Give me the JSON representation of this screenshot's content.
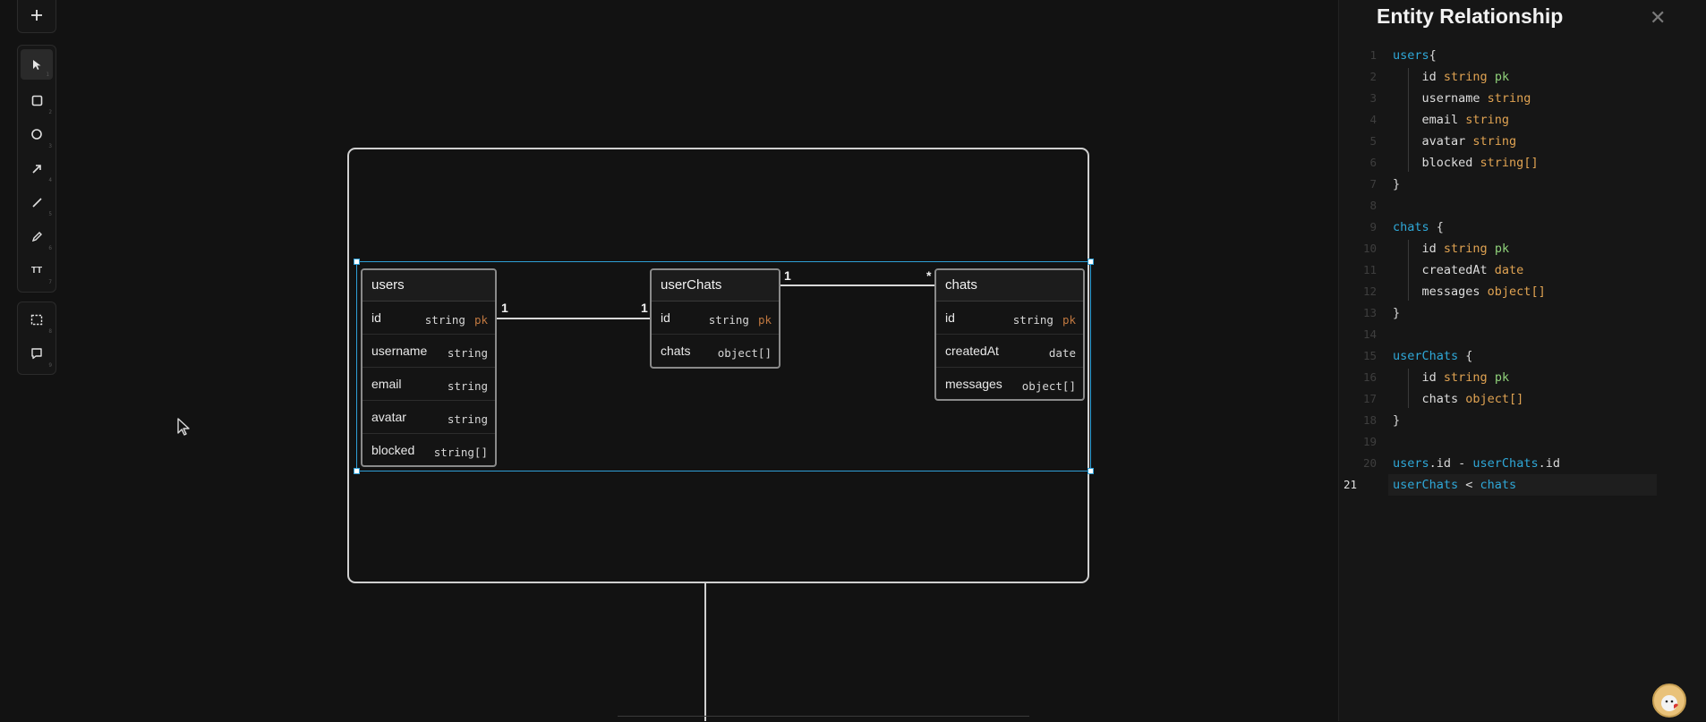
{
  "toolbar": {
    "add_button": {
      "icon": "plus-icon",
      "key": ""
    },
    "tools": [
      {
        "name": "select",
        "icon": "pointer-icon",
        "key": "1",
        "active": true
      },
      {
        "name": "rectangle",
        "icon": "square-icon",
        "key": "2"
      },
      {
        "name": "ellipse",
        "icon": "circle-icon",
        "key": "3"
      },
      {
        "name": "arrow",
        "icon": "arrow-icon",
        "key": "4"
      },
      {
        "name": "line",
        "icon": "line-icon",
        "key": "5"
      },
      {
        "name": "pencil",
        "icon": "pencil-icon",
        "key": "6"
      },
      {
        "name": "text",
        "icon": "text-icon",
        "label": "TT",
        "key": "7"
      }
    ],
    "extra": [
      {
        "name": "frame",
        "icon": "frame-icon",
        "key": "8"
      },
      {
        "name": "comment",
        "icon": "comment-icon",
        "key": "9"
      }
    ]
  },
  "diagram": {
    "entities": {
      "users": {
        "name": "users",
        "fields": [
          {
            "name": "id",
            "type": "string",
            "pk": "pk"
          },
          {
            "name": "username",
            "type": "string",
            "pk": ""
          },
          {
            "name": "email",
            "type": "string",
            "pk": ""
          },
          {
            "name": "avatar",
            "type": "string",
            "pk": ""
          },
          {
            "name": "blocked",
            "type": "string[]",
            "pk": ""
          }
        ]
      },
      "userChats": {
        "name": "userChats",
        "fields": [
          {
            "name": "id",
            "type": "string",
            "pk": "pk"
          },
          {
            "name": "chats",
            "type": "object[]",
            "pk": ""
          }
        ]
      },
      "chats": {
        "name": "chats",
        "fields": [
          {
            "name": "id",
            "type": "string",
            "pk": "pk"
          },
          {
            "name": "createdAt",
            "type": "date",
            "pk": ""
          },
          {
            "name": "messages",
            "type": "object[]",
            "pk": ""
          }
        ]
      }
    },
    "relations": {
      "users_userChats": {
        "from_card": "1",
        "to_card": "1"
      },
      "userChats_chats": {
        "from_card": "1",
        "to_card": "*"
      }
    }
  },
  "panel": {
    "title": "Entity Relationship",
    "close_icon": "close-icon",
    "current_line": 21,
    "code_lines": [
      [
        {
          "t": "users",
          "c": "ent"
        },
        {
          "t": "{",
          "c": "punc"
        }
      ],
      [
        {
          "t": "    id ",
          "c": "field"
        },
        {
          "t": "string ",
          "c": "type"
        },
        {
          "t": "pk",
          "c": "pk"
        }
      ],
      [
        {
          "t": "    username ",
          "c": "field"
        },
        {
          "t": "string",
          "c": "type"
        }
      ],
      [
        {
          "t": "    email ",
          "c": "field"
        },
        {
          "t": "string",
          "c": "type"
        }
      ],
      [
        {
          "t": "    avatar ",
          "c": "field"
        },
        {
          "t": "string",
          "c": "type"
        }
      ],
      [
        {
          "t": "    blocked ",
          "c": "field"
        },
        {
          "t": "string[]",
          "c": "type"
        }
      ],
      [
        {
          "t": "}",
          "c": "punc"
        }
      ],
      [],
      [
        {
          "t": "chats ",
          "c": "ent"
        },
        {
          "t": "{",
          "c": "punc"
        }
      ],
      [
        {
          "t": "    id ",
          "c": "field"
        },
        {
          "t": "string ",
          "c": "type"
        },
        {
          "t": "pk",
          "c": "pk"
        }
      ],
      [
        {
          "t": "    createdAt ",
          "c": "field"
        },
        {
          "t": "date",
          "c": "type"
        }
      ],
      [
        {
          "t": "    messages ",
          "c": "field"
        },
        {
          "t": "object[]",
          "c": "type"
        }
      ],
      [
        {
          "t": "}",
          "c": "punc"
        }
      ],
      [],
      [
        {
          "t": "userChats ",
          "c": "ent"
        },
        {
          "t": "{",
          "c": "punc"
        }
      ],
      [
        {
          "t": "    id ",
          "c": "field"
        },
        {
          "t": "string ",
          "c": "type"
        },
        {
          "t": "pk",
          "c": "pk"
        }
      ],
      [
        {
          "t": "    chats ",
          "c": "field"
        },
        {
          "t": "object[]",
          "c": "type"
        }
      ],
      [
        {
          "t": "}",
          "c": "punc"
        }
      ],
      [],
      [
        {
          "t": "users",
          "c": "ent"
        },
        {
          "t": ".id - ",
          "c": "punc"
        },
        {
          "t": "userChats",
          "c": "ent"
        },
        {
          "t": ".id",
          "c": "punc"
        }
      ],
      [
        {
          "t": "userChats",
          "c": "ent"
        },
        {
          "t": " < ",
          "c": "punc"
        },
        {
          "t": "chats",
          "c": "ent"
        }
      ]
    ]
  },
  "colors": {
    "background": "#121212",
    "selection": "#2e9fd6",
    "entity_keyword": "#2fa8d8",
    "type_keyword": "#e0a352",
    "pk_keyword": "#8fd17a"
  }
}
